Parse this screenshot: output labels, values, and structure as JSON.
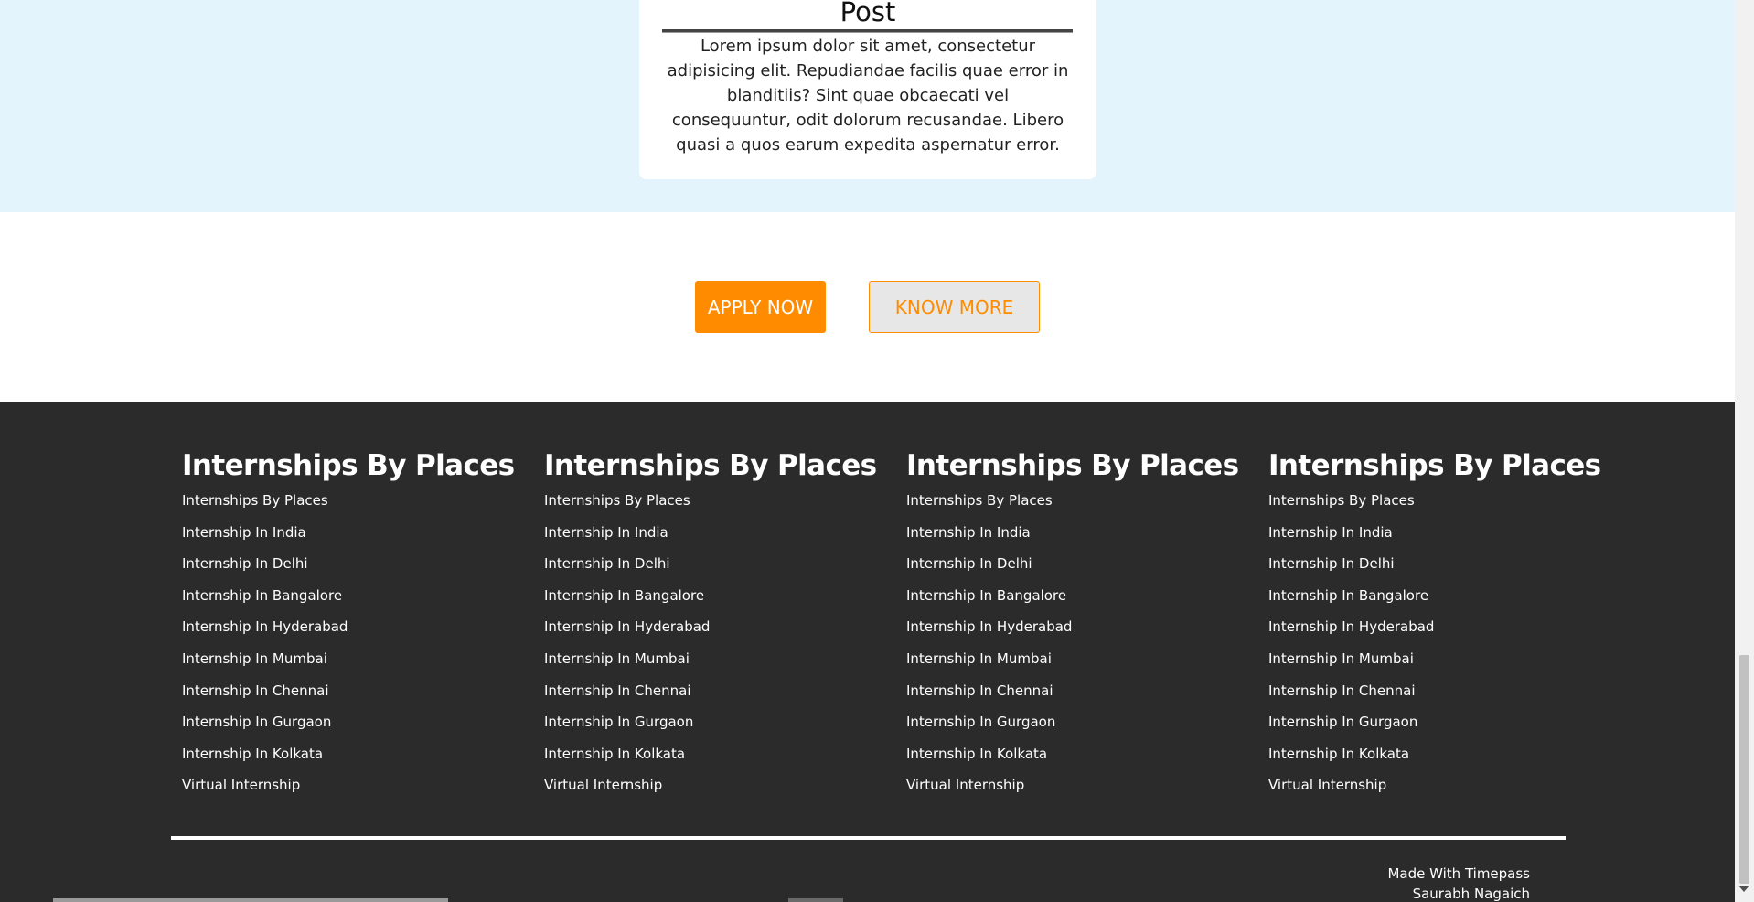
{
  "post_card": {
    "title": "Post",
    "body": "Lorem ipsum dolor sit amet, consectetur adipisicing elit. Repudiandae facilis quae error in blanditiis? Sint quae obcaecati vel consequuntur, odit dolorum recusandae. Libero quasi a quos earum expedita aspernatur error."
  },
  "actions": {
    "apply_label": "APPLY NOW",
    "know_label": "KNOW MORE"
  },
  "footer": {
    "columns": [
      {
        "heading": "Internships By Places",
        "links": [
          "Internships By Places",
          "Internship In India",
          "Internship In Delhi",
          "Internship In Bangalore",
          "Internship In Hyderabad",
          "Internship In Mumbai",
          "Internship In Chennai",
          "Internship In Gurgaon",
          "Internship In Kolkata",
          "Virtual Internship"
        ]
      },
      {
        "heading": "Internships By Places",
        "links": [
          "Internships By Places",
          "Internship In India",
          "Internship In Delhi",
          "Internship In Bangalore",
          "Internship In Hyderabad",
          "Internship In Mumbai",
          "Internship In Chennai",
          "Internship In Gurgaon",
          "Internship In Kolkata",
          "Virtual Internship"
        ]
      },
      {
        "heading": "Internships By Places",
        "links": [
          "Internships By Places",
          "Internship In India",
          "Internship In Delhi",
          "Internship In Bangalore",
          "Internship In Hyderabad",
          "Internship In Mumbai",
          "Internship In Chennai",
          "Internship In Gurgaon",
          "Internship In Kolkata",
          "Virtual Internship"
        ]
      },
      {
        "heading": "Internships By Places",
        "links": [
          "Internships By Places",
          "Internship In India",
          "Internship In Delhi",
          "Internship In Bangalore",
          "Internship In Hyderabad",
          "Internship In Mumbai",
          "Internship In Chennai",
          "Internship In Gurgaon",
          "Internship In Kolkata",
          "Virtual Internship"
        ]
      }
    ],
    "credit_line1": "Made With Timepass",
    "credit_line2": "Saurabh Nagaich"
  },
  "colors": {
    "hero_bg": "#e3f4fd",
    "accent": "#ff8c00",
    "footer_bg": "#2b2b2b"
  }
}
